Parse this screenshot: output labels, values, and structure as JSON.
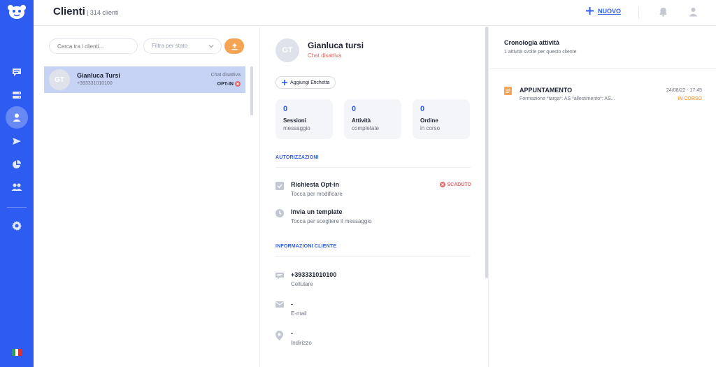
{
  "colors": {
    "accent": "#2e5cf0",
    "upload": "#f5a453",
    "danger": "#e06a6a",
    "selected_row": "#c7d3f5"
  },
  "sidebar": {
    "logo_icon": "mascot-logo-icon",
    "items": [
      {
        "icon": "chat-icon",
        "active": false
      },
      {
        "icon": "stack-icon",
        "active": false
      },
      {
        "icon": "user-icon",
        "active": true
      },
      {
        "icon": "send-icon",
        "active": false
      },
      {
        "icon": "pie-chart-icon",
        "active": false
      },
      {
        "icon": "team-icon",
        "active": false
      },
      {
        "icon": "gear-icon",
        "active": false
      }
    ],
    "flag_icon": "italy-flag-icon"
  },
  "header": {
    "title": "Clienti",
    "count": "| 314 clienti",
    "new_label": "NUOVO"
  },
  "left": {
    "search_placeholder": "Cerca tra i clienti...",
    "filter_placeholder": "Filtra per stato",
    "contacts": [
      {
        "initials": "GT",
        "name": "Gianluca Tursi",
        "phone": "+393331010100",
        "status": "Chat disattiva",
        "optin": "OPT-IN"
      }
    ]
  },
  "detail": {
    "initials": "GT",
    "name": "Gianluca tursi",
    "status": "Chat disattiva",
    "add_tag_label": "Aggiungi Etichetta",
    "stats": [
      {
        "value": "0",
        "title": "Sessioni",
        "sub": "messaggio"
      },
      {
        "value": "0",
        "title": "Attività",
        "sub": "completate"
      },
      {
        "value": "0",
        "title": "Ordine",
        "sub": "in corso"
      }
    ],
    "auth_title": "AUTORIZZAZIONI",
    "auth_items": [
      {
        "title": "Richiesta Opt-in",
        "sub": "Tocca per modificare",
        "badge": "SCADUTO"
      },
      {
        "title": "Invia un template",
        "sub": "Tocca per scegliere il messaggio"
      }
    ],
    "info_title": "INFORMAZIONI CLIENTE",
    "info_items": [
      {
        "value": "+393331010100",
        "label": "Cellulare"
      },
      {
        "value": "-",
        "label": "E-mail"
      },
      {
        "value": "-",
        "label": "Indirizzo"
      }
    ]
  },
  "history": {
    "title": "Cronologia attività",
    "subtitle": "1 attività svolte per questo cliente",
    "items": [
      {
        "title": "APPUNTAMENTO",
        "desc": "Formazione *targa*: AS *allestimento*: AS...",
        "date": "24/08/22 - 17:45",
        "status": "IN CORSO"
      }
    ]
  }
}
